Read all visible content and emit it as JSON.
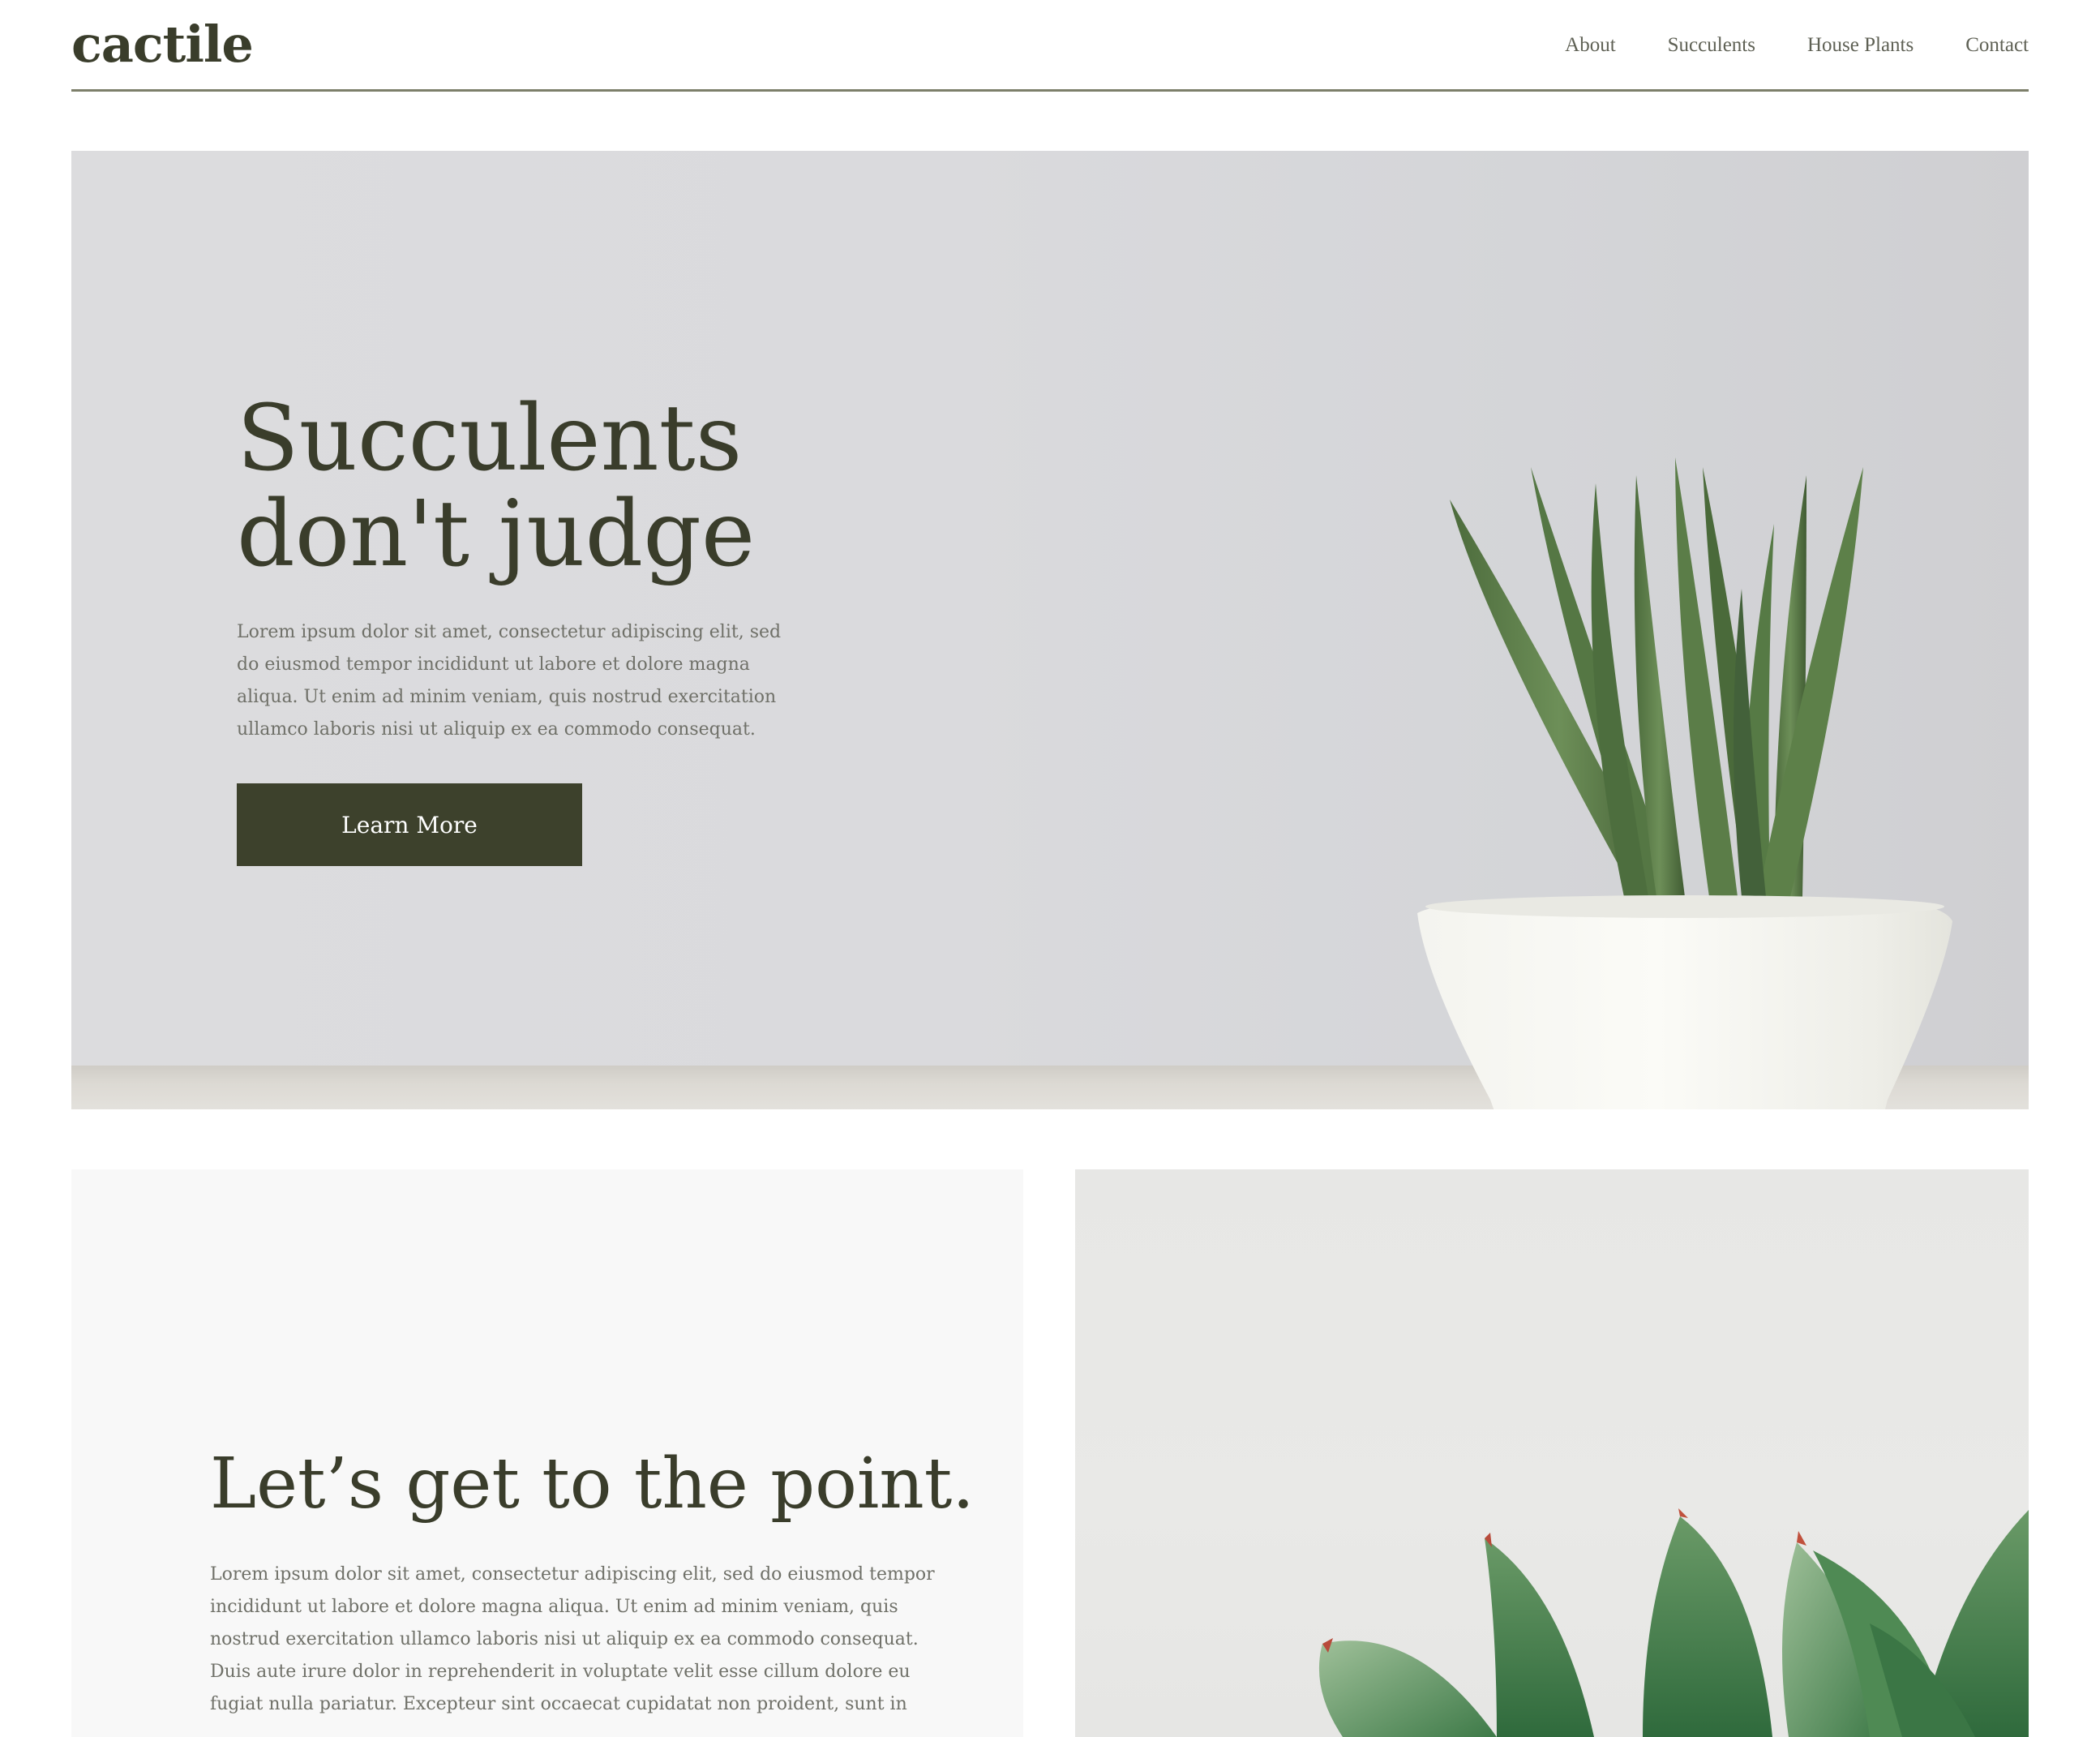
{
  "header": {
    "logo": "cactile",
    "nav": [
      "About",
      "Succulents",
      "House Plants",
      "Contact"
    ]
  },
  "hero": {
    "title_line1": "Succulents",
    "title_line2": "don't judge",
    "text": "Lorem ipsum dolor sit amet, consectetur adipiscing elit, sed do eiusmod tempor incididunt ut labore et dolore magna aliqua. Ut enim ad minim veniam, quis nostrud exercitation ullamco laboris nisi ut aliquip ex ea commodo consequat.",
    "button_label": "Learn More"
  },
  "section": {
    "title": "Let’s get to the point.",
    "text": "Lorem ipsum dolor sit amet, consectetur adipiscing elit, sed do eiusmod tempor incididunt ut labore et dolore magna aliqua. Ut enim ad minim veniam, quis nostrud exercitation ullamco laboris nisi ut aliquip ex ea commodo consequat. Duis aute irure dolor in reprehenderit in voluptate velit esse cillum dolore eu fugiat nulla pariatur. Excepteur sint occaecat cupidatat non proident, sunt in"
  },
  "colors": {
    "brand_dark": "#3a3d2b",
    "button": "#3d412c",
    "body_text": "#6f7068",
    "divider": "#7d7f6a"
  },
  "images": {
    "hero": "snake-plant-in-white-pot",
    "section": "succulent-rosette-closeup"
  }
}
